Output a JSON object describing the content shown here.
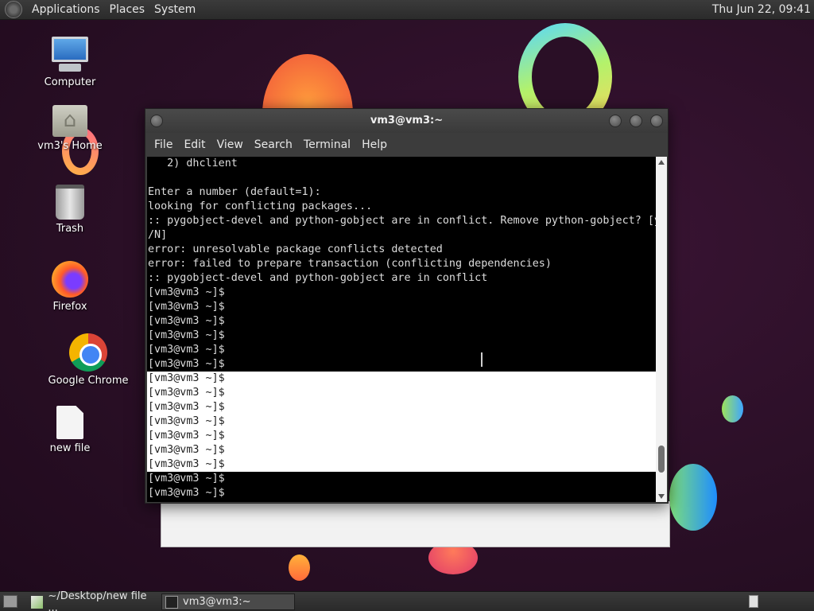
{
  "top_panel": {
    "menus": [
      "Applications",
      "Places",
      "System"
    ],
    "clock": "Thu Jun 22, 09:41"
  },
  "desktop_icons": [
    {
      "label": "Computer",
      "icon": "computer-icon"
    },
    {
      "label": "vm3's Home",
      "icon": "home-folder-icon"
    },
    {
      "label": "Trash",
      "icon": "trash-icon"
    },
    {
      "label": "Firefox",
      "icon": "firefox-icon"
    },
    {
      "label": "Google Chrome",
      "icon": "chrome-icon"
    },
    {
      "label": "new file",
      "icon": "file-icon"
    }
  ],
  "terminal": {
    "title": "vm3@vm3:~",
    "menu": [
      "File",
      "Edit",
      "View",
      "Search",
      "Terminal",
      "Help"
    ],
    "lines": [
      "   2) dhclient",
      "",
      "Enter a number (default=1):",
      "looking for conflicting packages...",
      ":: pygobject-devel and python-gobject are in conflict. Remove python-gobject? [y",
      "/N]",
      "error: unresolvable package conflicts detected",
      "error: failed to prepare transaction (conflicting dependencies)",
      ":: pygobject-devel and python-gobject are in conflict",
      "[vm3@vm3 ~]$",
      "[vm3@vm3 ~]$",
      "[vm3@vm3 ~]$",
      "[vm3@vm3 ~]$",
      "[vm3@vm3 ~]$",
      "[vm3@vm3 ~]$",
      "[vm3@vm3 ~]$",
      "[vm3@vm3 ~]$",
      "[vm3@vm3 ~]$",
      "[vm3@vm3 ~]$",
      "[vm3@vm3 ~]$",
      "[vm3@vm3 ~]$",
      "[vm3@vm3 ~]$",
      "[vm3@vm3 ~]$",
      "[vm3@vm3 ~]$"
    ]
  },
  "taskbar": {
    "tasks": [
      {
        "label": "~/Desktop/new file ...",
        "icon": "text-editor-icon"
      },
      {
        "label": "vm3@vm3:~",
        "icon": "terminal-icon"
      }
    ]
  }
}
